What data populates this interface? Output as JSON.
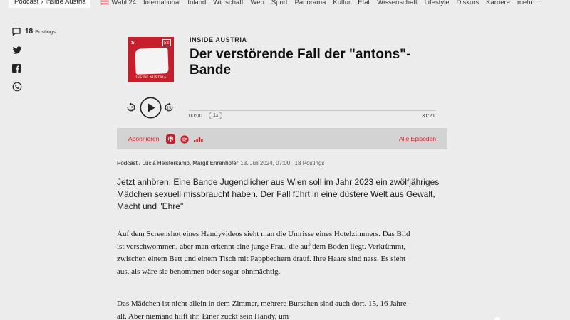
{
  "nav": {
    "breadcrumb_section": "Podcast",
    "breadcrumb_separator": "›",
    "breadcrumb_current": "Inside Austria",
    "items": [
      "Wahl 24",
      "International",
      "Inland",
      "Wirtschaft",
      "Web",
      "Sport",
      "Panorama",
      "Kultur",
      "Etat",
      "Wissenschaft",
      "Lifestyle",
      "Diskurs",
      "Karriere",
      "mehr..."
    ]
  },
  "share": {
    "postings_count": "18",
    "postings_label": "Postings",
    "icons": [
      "comment-icon",
      "twitter-icon",
      "facebook-icon",
      "whatsapp-icon"
    ]
  },
  "podcast": {
    "cover": {
      "s_badge": "S",
      "st_badge": "ST",
      "title": "INSIDE AUSTRIA",
      "color": "#c41f2a"
    },
    "kicker": "INSIDE AUSTRIA",
    "title": "Der verstörende Fall der \"antons\"-Bande",
    "time_current": "00:00",
    "speed": "1x",
    "time_total": "31:21",
    "progress": 0,
    "subscribe_label": "Abonnieren",
    "all_episodes_label": "Alle Episoden",
    "platform_icons": [
      "apple-podcasts-icon",
      "spotify-icon",
      "deezer-icon"
    ]
  },
  "article": {
    "byline_authors": "Podcast / Lucia Heisterkamp, Margit Ehrenhöfer",
    "date": "13. Juli 2024, 07:00.",
    "postings_link": "18 Postings",
    "lead": "Jetzt anhören: Eine Bande Jugendlicher aus Wien soll im Jahr 2023 ein zwölfjähriges Mädchen sexuell missbraucht haben. Der Fall führt in eine düstere Welt aus Gewalt, Macht und \"Ehre\"",
    "paragraphs": [
      "Auf dem Screenshot eines Handyvideos sieht man die Umrisse eines Hotelzimmers. Das Bild ist verschwommen, aber man erkennt eine junge Frau, die auf dem Boden liegt. Verkrümmt, zwischen einem Bett und einem Tisch mit Pappbechern drauf. Ihre Haare sind nass. Es sieht aus, als wäre sie benommen oder sogar ohnmächtig.",
      "Das Mädchen ist nicht allein in dem Zimmer, mehrere Burschen sind auch dort. 15, 16 Jahre alt. Aber niemand hilft ihr. Einer zückt sein Handy, um"
    ]
  },
  "colors": {
    "background": "#ececec",
    "accent": "#c41f2a",
    "player_bar": "#d3d3d3"
  }
}
